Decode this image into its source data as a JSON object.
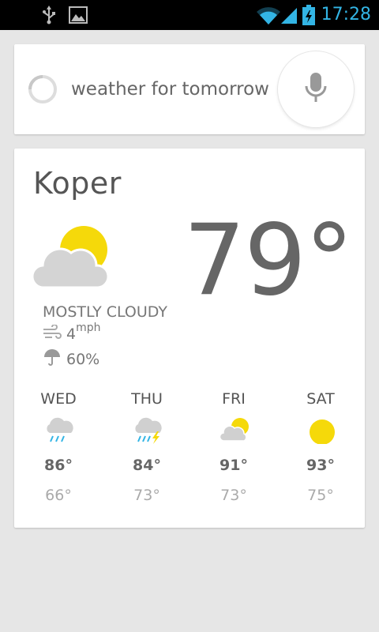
{
  "status_bar": {
    "time": "17:28",
    "icons": [
      "usb-icon",
      "image-notification-icon",
      "wifi-icon",
      "signal-icon",
      "battery-charging-icon"
    ],
    "accent_color": "#33b5e5"
  },
  "search": {
    "query": "weather for tomorrow",
    "mic_icon": "microphone-icon"
  },
  "weather": {
    "city": "Koper",
    "temperature": "79°",
    "condition": "MOSTLY CLOUDY",
    "condition_icon": "mostly-cloudy-icon",
    "wind_value": "4",
    "wind_unit": "mph",
    "humidity": "60%",
    "sun_color": "#f5d90a",
    "forecast": [
      {
        "day": "WED",
        "icon": "rain-icon",
        "high": "86°",
        "low": "66°"
      },
      {
        "day": "THU",
        "icon": "thunderstorm-icon",
        "high": "84°",
        "low": "73°"
      },
      {
        "day": "FRI",
        "icon": "partly-cloudy-icon",
        "high": "91°",
        "low": "73°"
      },
      {
        "day": "SAT",
        "icon": "sunny-icon",
        "high": "93°",
        "low": "75°"
      }
    ]
  }
}
